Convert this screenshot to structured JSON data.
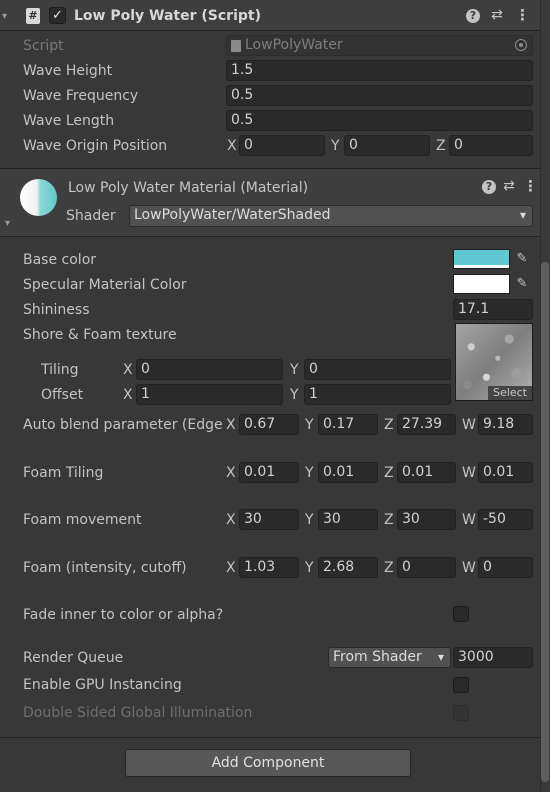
{
  "component": {
    "title": "Low Poly Water (Script)",
    "script_label": "Script",
    "script_value": "LowPolyWater",
    "fields": [
      {
        "label": "Wave Height",
        "value": "1.5"
      },
      {
        "label": "Wave Frequency",
        "value": "0.5"
      },
      {
        "label": "Wave Length",
        "value": "0.5"
      }
    ],
    "origin": {
      "label": "Wave Origin Position",
      "x_label": "X",
      "x": "0",
      "y_label": "Y",
      "y": "0",
      "z_label": "Z",
      "z": "0"
    }
  },
  "material": {
    "title": "Low Poly Water Material (Material)",
    "shader_label": "Shader",
    "shader_value": "LowPolyWater/WaterShaded"
  },
  "props": {
    "base_color": {
      "label": "Base color",
      "color": "#5fc8d2"
    },
    "specular": {
      "label": "Specular Material Color",
      "color": "#ffffff"
    },
    "shininess": {
      "label": "Shininess",
      "value": "17.1"
    },
    "foam_texture": {
      "label": "Shore & Foam texture",
      "select_label": "Select",
      "tiling": {
        "label": "Tiling",
        "x_label": "X",
        "x": "0",
        "y_label": "Y",
        "y": "0"
      },
      "offset": {
        "label": "Offset",
        "x_label": "X",
        "x": "1",
        "y_label": "Y",
        "y": "1"
      }
    },
    "vectors": [
      {
        "label": "Auto blend parameter (Edge",
        "x": "0.67",
        "y": "0.17",
        "z": "27.39",
        "w": "9.18"
      },
      {
        "label": "Foam Tiling",
        "x": "0.01",
        "y": "0.01",
        "z": "0.01",
        "w": "0.01"
      },
      {
        "label": "Foam movement",
        "x": "30",
        "y": "30",
        "z": "30",
        "w": "-50"
      },
      {
        "label": "Foam (intensity, cutoff)",
        "x": "1.03",
        "y": "2.68",
        "z": "0",
        "w": "0"
      }
    ],
    "axis": {
      "x": "X",
      "y": "Y",
      "z": "Z",
      "w": "W"
    },
    "fade": {
      "label": "Fade inner to color or alpha?",
      "checked": false
    },
    "render_queue": {
      "label": "Render Queue",
      "mode": "From Shader",
      "value": "3000"
    },
    "gpu_instancing": {
      "label": "Enable GPU Instancing",
      "checked": false
    },
    "double_sided_gi": {
      "label": "Double Sided Global Illumination",
      "checked": false
    }
  },
  "add_component_label": "Add Component",
  "icons": {
    "help": "?",
    "settings": "⇄",
    "more": "⋮",
    "script": "#",
    "check": "✓",
    "dropdown": "▾"
  }
}
